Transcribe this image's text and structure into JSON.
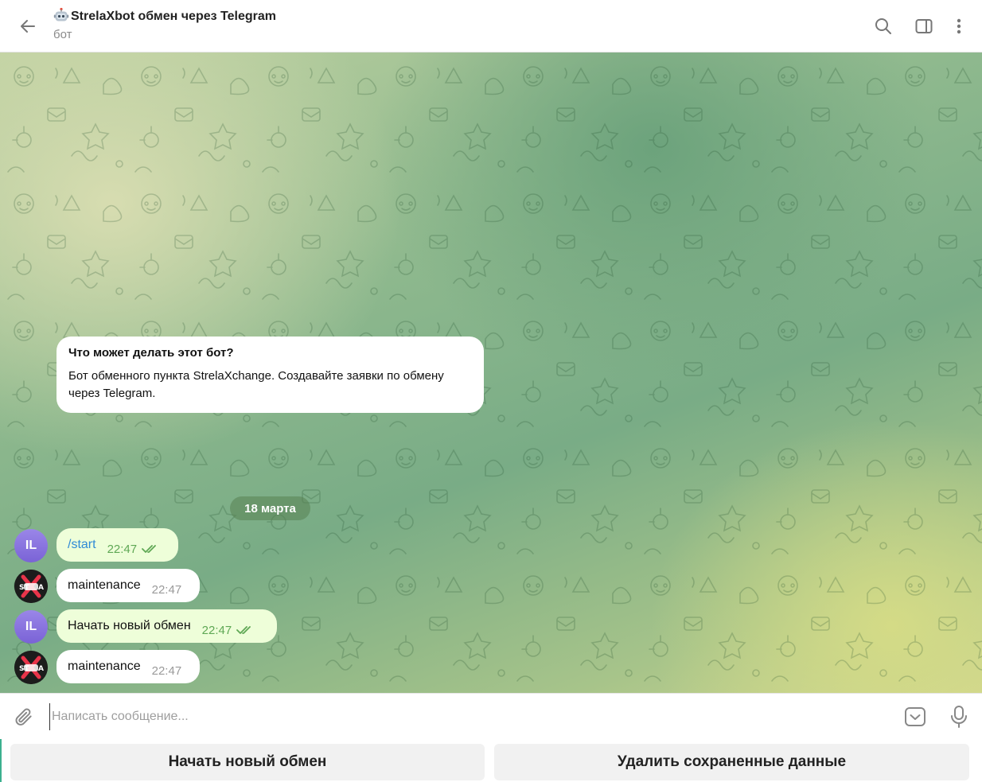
{
  "header": {
    "title": "StrelaXbot обмен через Telegram",
    "subtitle": "бот",
    "icons": [
      "back-arrow-icon",
      "search-icon",
      "sidebar-toggle-icon",
      "more-vertical-icon"
    ]
  },
  "info_card": {
    "title": "Что может делать этот бот?",
    "text": "Бот обменного пункта StrelaXchange. Создавайте заявки по обмену через Telegram."
  },
  "date_separator": "18 марта",
  "messages": [
    {
      "from": "user",
      "avatar": "IL",
      "text": "/start",
      "time": "22:47",
      "read": true
    },
    {
      "from": "bot",
      "avatar_text": "ST",
      "text": "maintenance",
      "time": "22:47"
    },
    {
      "from": "user",
      "avatar": "IL",
      "text": "Начать новый обмен",
      "time": "22:47",
      "read": true
    },
    {
      "from": "bot",
      "avatar_text": "ST",
      "text": "maintenance",
      "time": "22:47"
    }
  ],
  "composer": {
    "placeholder": "Написать сообщение..."
  },
  "reply_keyboard": {
    "buttons": [
      "Начать новый обмен",
      "Удалить сохраненные данные"
    ]
  },
  "colors": {
    "outgoing_bubble": "#eefed9",
    "incoming_bubble": "#ffffff",
    "link": "#2f8ad6",
    "read_check": "#5fa855",
    "user_avatar": "#8a74df"
  }
}
